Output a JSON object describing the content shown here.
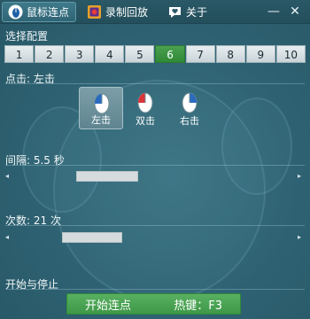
{
  "tabs": [
    {
      "label": "鼠标连点",
      "icon": "mouse-icon",
      "active": true
    },
    {
      "label": "录制回放",
      "icon": "record-icon",
      "active": false
    },
    {
      "label": "关于",
      "icon": "heart-chat-icon",
      "active": false
    }
  ],
  "window": {
    "minimize": "—",
    "close": "✕"
  },
  "config": {
    "section_label": "选择配置",
    "options": [
      "1",
      "2",
      "3",
      "4",
      "5",
      "6",
      "7",
      "8",
      "9",
      "10"
    ],
    "selected": "6"
  },
  "click": {
    "label": "点击: 左击",
    "options": [
      {
        "label": "左击",
        "icon": "mouse-left-icon",
        "selected": true
      },
      {
        "label": "双击",
        "icon": "mouse-double-icon",
        "selected": false
      },
      {
        "label": "右击",
        "icon": "mouse-right-icon",
        "selected": false
      }
    ]
  },
  "interval": {
    "label": "间隔: 5.5 秒",
    "value": 5.5,
    "unit": "秒"
  },
  "count": {
    "label": "次数: 21 次",
    "value": 21,
    "unit": "次"
  },
  "start_stop": {
    "section_label": "开始与停止",
    "button_label": "开始连点",
    "hotkey_label": "热键：F3"
  },
  "colors": {
    "accent_green": "#3e9848",
    "background": "#2f6170"
  }
}
